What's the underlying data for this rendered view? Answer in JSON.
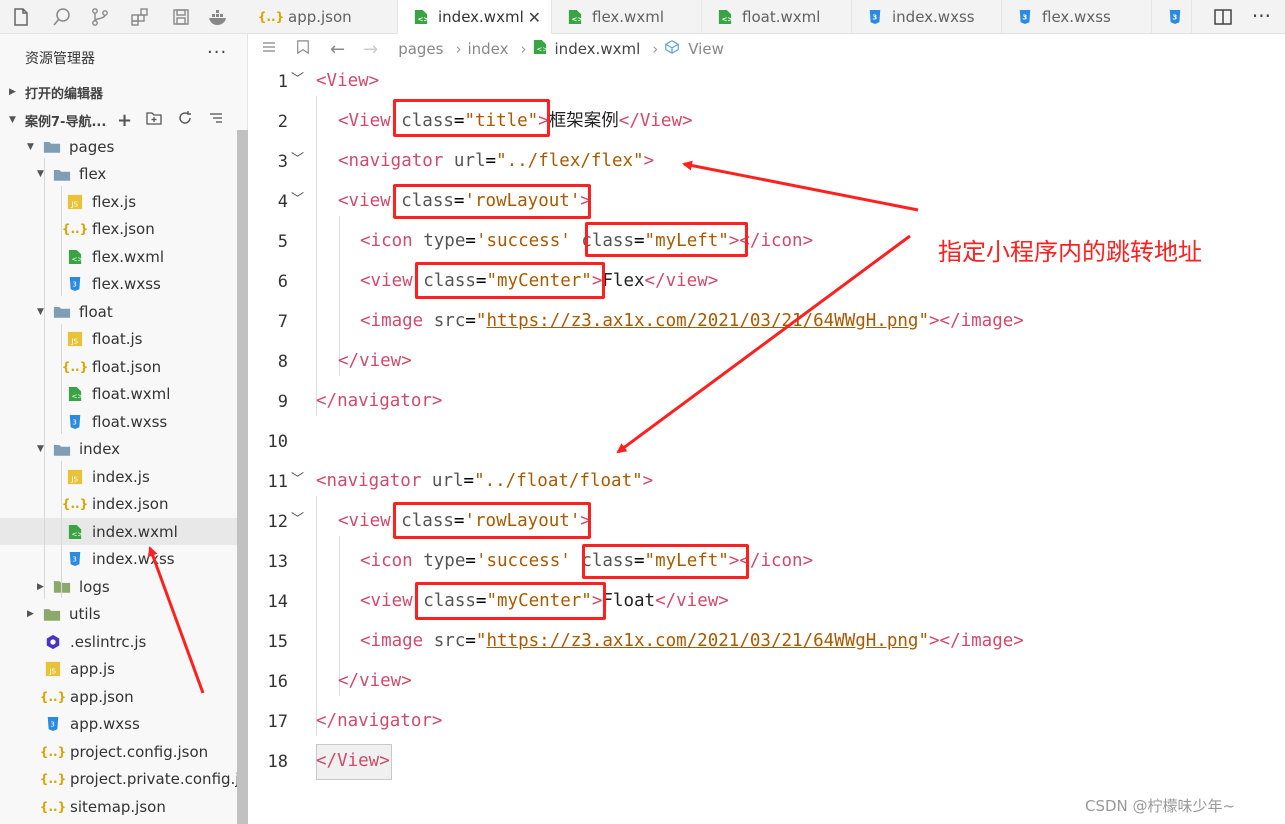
{
  "tabs": [
    {
      "label": "app.json",
      "icon": "json-icon"
    },
    {
      "label": "index.wxml",
      "icon": "wxml-icon",
      "active": true
    },
    {
      "label": "flex.wxml",
      "icon": "wxml-icon"
    },
    {
      "label": "float.wxml",
      "icon": "wxml-icon"
    },
    {
      "label": "index.wxss",
      "icon": "wxss-icon"
    },
    {
      "label": "flex.wxss",
      "icon": "wxss-icon"
    }
  ],
  "sidebar": {
    "title": "资源管理器",
    "dots": "···",
    "open_editors": "打开的编辑器",
    "project": "案例7-导航...",
    "tree": [
      {
        "label": "pages",
        "type": "folder-open"
      },
      {
        "label": "flex",
        "type": "folder-open"
      },
      {
        "label": "flex.js",
        "type": "js"
      },
      {
        "label": "flex.json",
        "type": "json"
      },
      {
        "label": "flex.wxml",
        "type": "wxml"
      },
      {
        "label": "flex.wxss",
        "type": "wxss"
      },
      {
        "label": "float",
        "type": "folder-open"
      },
      {
        "label": "float.js",
        "type": "js"
      },
      {
        "label": "float.json",
        "type": "json"
      },
      {
        "label": "float.wxml",
        "type": "wxml"
      },
      {
        "label": "float.wxss",
        "type": "wxss"
      },
      {
        "label": "index",
        "type": "folder-open"
      },
      {
        "label": "index.js",
        "type": "js"
      },
      {
        "label": "index.json",
        "type": "json"
      },
      {
        "label": "index.wxml",
        "type": "wxml",
        "selected": true
      },
      {
        "label": "index.wxss",
        "type": "wxss"
      },
      {
        "label": "logs",
        "type": "folder"
      },
      {
        "label": "utils",
        "type": "folder"
      },
      {
        "label": ".eslintrc.js",
        "type": "eslint"
      },
      {
        "label": "app.js",
        "type": "js"
      },
      {
        "label": "app.json",
        "type": "json"
      },
      {
        "label": "app.wxss",
        "type": "wxss"
      },
      {
        "label": "project.config.json",
        "type": "json"
      },
      {
        "label": "project.private.config.js...",
        "type": "json"
      },
      {
        "label": "sitemap.json",
        "type": "json"
      }
    ]
  },
  "breadcrumb": {
    "items": [
      "pages",
      "index",
      "index.wxml",
      "View"
    ]
  },
  "code": {
    "line_numbers": [
      "1",
      "2",
      "3",
      "4",
      "5",
      "6",
      "7",
      "8",
      "9",
      "10",
      "11",
      "12",
      "13",
      "14",
      "15",
      "16",
      "17",
      "18"
    ],
    "url": "https://z3.ax1x.com/2021/03/21/64WWgH.png",
    "text_title": "框架案例",
    "text_flex": "Flex",
    "text_float": "Float"
  },
  "annotation": "指定小程序内的跳转地址",
  "watermark": "CSDN @柠檬味少年~",
  "colors": {
    "tag": "#d04b6a",
    "string": "#a85a00",
    "annotation": "#ff2020"
  }
}
